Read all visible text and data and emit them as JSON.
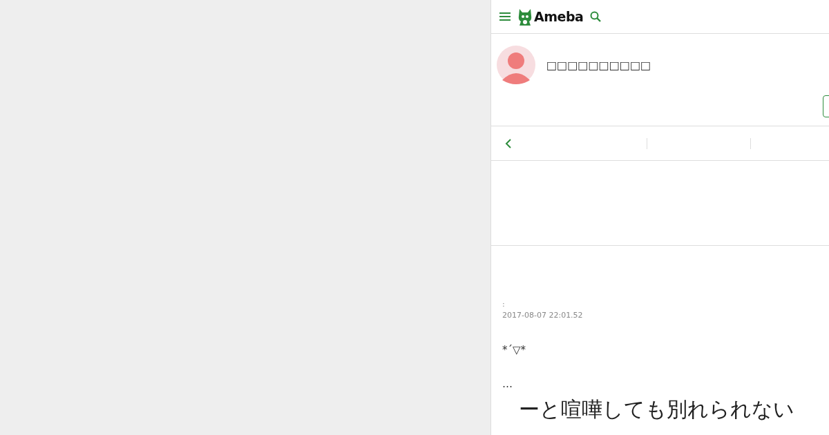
{
  "header": {
    "logo": "Ameba"
  },
  "blog": {
    "title": "□□□□□□□□□□"
  },
  "article": {
    "label": ":",
    "date": "2017-08-07 22:01.52",
    "paragraphs": [
      "*´▽*",
      "…"
    ],
    "heading": "ーと喧嘩しても別れられない"
  }
}
